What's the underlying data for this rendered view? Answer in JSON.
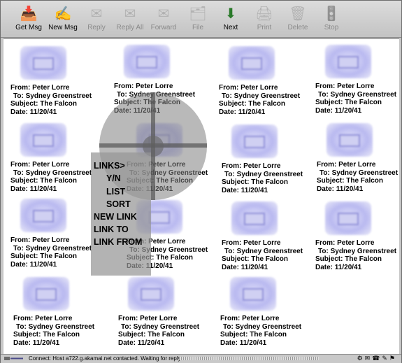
{
  "toolbar": {
    "buttons": [
      {
        "label": "Get Msg",
        "icon": "get-mail-icon",
        "glyph": "📥"
      },
      {
        "label": "New Msg",
        "icon": "new-message-icon",
        "glyph": "✍"
      },
      {
        "label": "Reply",
        "icon": "reply-icon",
        "glyph": "✉"
      },
      {
        "label": "Reply All",
        "icon": "reply-all-icon",
        "glyph": "✉"
      },
      {
        "label": "Forward",
        "icon": "forward-icon",
        "glyph": "✉"
      },
      {
        "label": "File",
        "icon": "file-icon",
        "glyph": "🗂"
      },
      {
        "label": "Next",
        "icon": "next-icon",
        "glyph": "⬇"
      },
      {
        "label": "Print",
        "icon": "print-icon",
        "glyph": "🖨"
      },
      {
        "label": "Delete",
        "icon": "delete-icon",
        "glyph": "🗑"
      },
      {
        "label": "Stop",
        "icon": "stop-icon",
        "glyph": "🚦"
      }
    ]
  },
  "message": {
    "from": "From:  Peter Lorre",
    "to": "To:  Sydney Greenstreet",
    "subject": "Subject:  The Falcon",
    "date": "Date:  11/20/41"
  },
  "menu": {
    "items": [
      "LINKS>",
      "Y/N",
      "LIST",
      "SORT",
      "NEW LINK",
      "LINK TO",
      "LINK FROM"
    ]
  },
  "status": {
    "text": "Connect: Host a722.g.akamai.net contacted. Waiting for reply..."
  }
}
